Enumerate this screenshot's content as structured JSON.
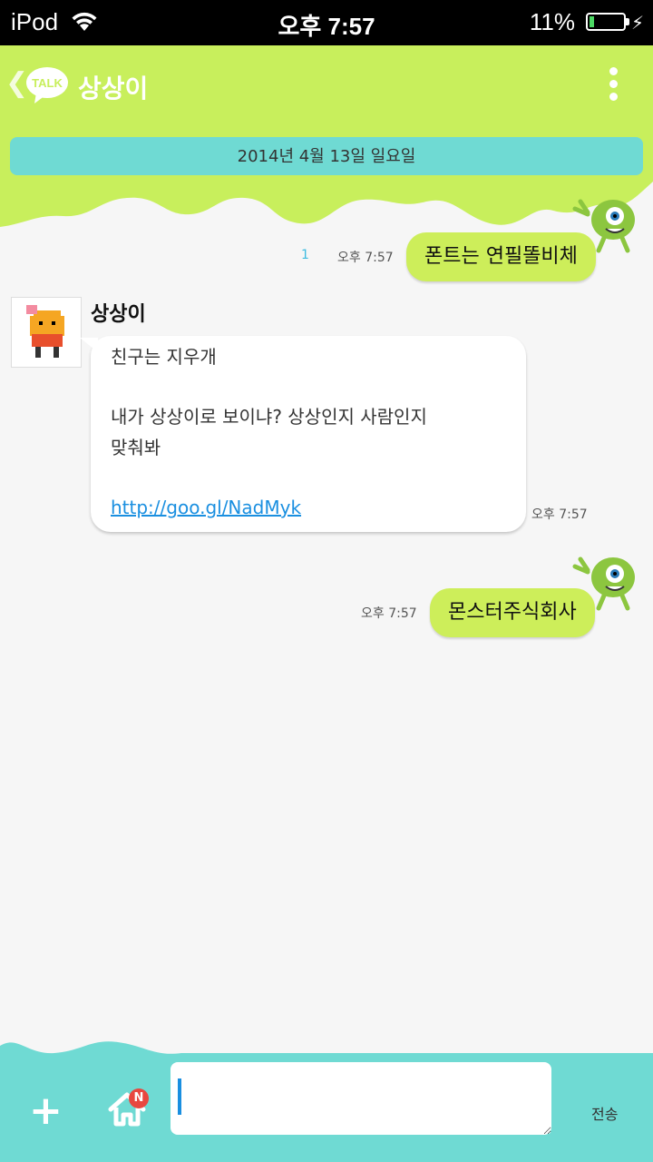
{
  "status_bar": {
    "carrier": "iPod",
    "time": "오후 7:57",
    "battery_percent": "11%",
    "battery_level": 0.11
  },
  "header": {
    "logo_text": "TALK",
    "title": "상상이",
    "accent_color": "#c8ef5c"
  },
  "date_banner": "2014년 4월 13일 일요일",
  "messages": [
    {
      "side": "out",
      "text": "폰트는 연필똘비체",
      "time": "오후 7:57",
      "read_count": "1"
    },
    {
      "side": "in",
      "sender": "상상이",
      "lines": [
        "친구는 지우개",
        "내가 상상이로 보이냐? 상상인지 사람인지",
        "맞춰봐"
      ],
      "link": "http://goo.gl/NadMyk",
      "time": "오후 7:57"
    },
    {
      "side": "out",
      "text": "몬스터주식회사",
      "time": "오후 7:57",
      "read_count": ""
    }
  ],
  "bottom": {
    "badge": "N",
    "send_label": "전송",
    "input_value": ""
  },
  "colors": {
    "header_green": "#c8ef5c",
    "bubble_out": "#cdee5a",
    "teal": "#6fdad3",
    "link": "#1a8fe0"
  }
}
